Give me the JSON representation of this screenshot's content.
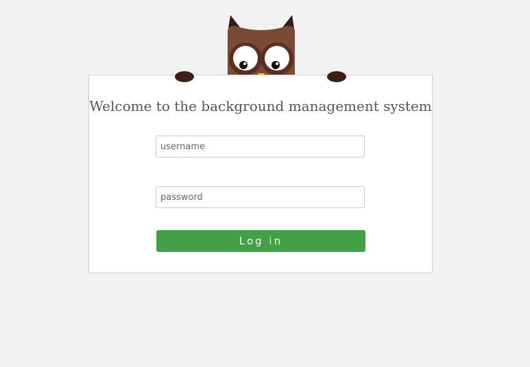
{
  "login": {
    "title": "Welcome to the background management system",
    "username_placeholder": "username",
    "password_placeholder": "password",
    "username_value": "",
    "password_value": "",
    "submit_label": "Log in"
  },
  "colors": {
    "page_background": "#f2f2f2",
    "panel_background": "#ffffff",
    "button": "#43a047",
    "owl_body": "#7a4a35",
    "owl_dark": "#3d2119",
    "beak": "#f5c400"
  },
  "icons": {
    "mascot": "owl-mascot-icon"
  }
}
